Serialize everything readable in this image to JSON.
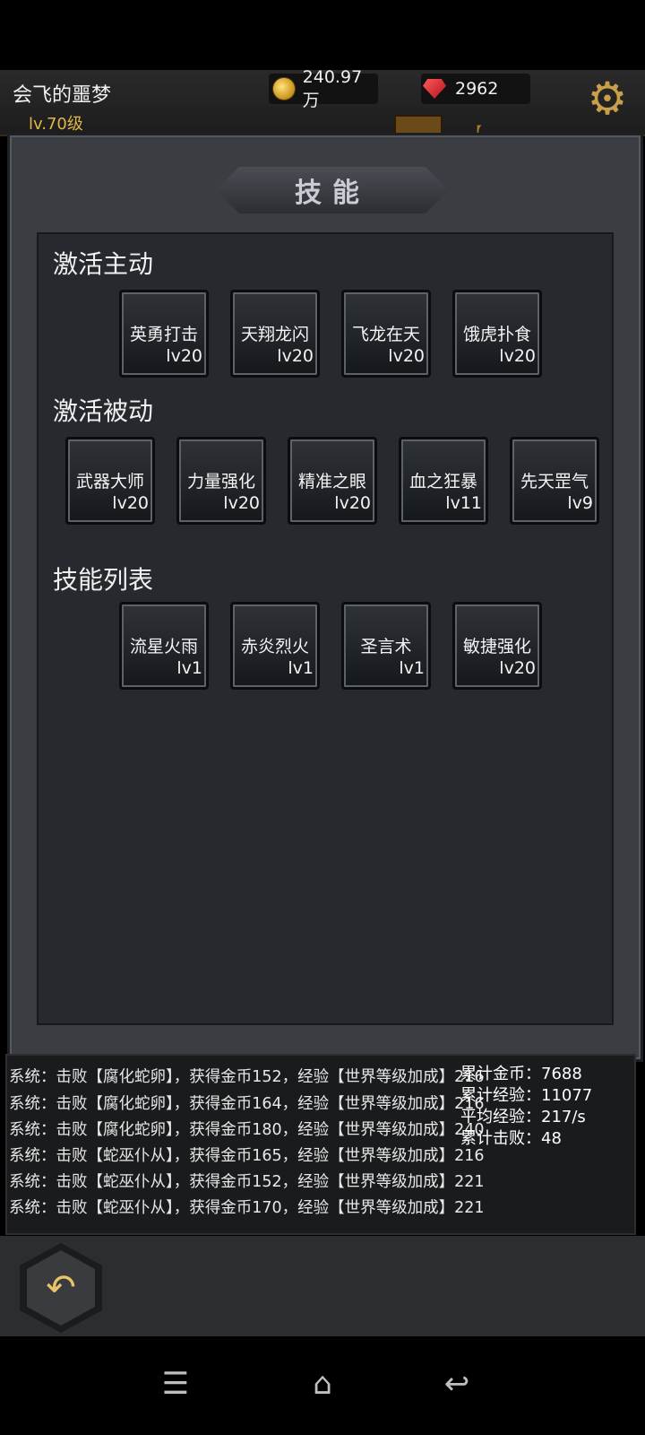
{
  "header": {
    "player_name": "会飞的噩梦",
    "player_level": "lv.70级",
    "gold": "240.97万",
    "gems": "2962",
    "partial_banner": "【"
  },
  "panel": {
    "title": "技能",
    "sections": [
      {
        "title": "激活主动",
        "skills": [
          {
            "name": "英勇打击",
            "level": "lv20"
          },
          {
            "name": "天翔龙闪",
            "level": "lv20"
          },
          {
            "name": "飞龙在天",
            "level": "lv20"
          },
          {
            "name": "饿虎扑食",
            "level": "lv20"
          }
        ]
      },
      {
        "title": "激活被动",
        "skills": [
          {
            "name": "武器大师",
            "level": "lv20"
          },
          {
            "name": "力量强化",
            "level": "lv20"
          },
          {
            "name": "精准之眼",
            "level": "lv20"
          },
          {
            "name": "血之狂暴",
            "level": "lv11"
          },
          {
            "name": "先天罡气",
            "level": "lv9"
          }
        ]
      },
      {
        "title": "技能列表",
        "skills": [
          {
            "name": "流星火雨",
            "level": "lv1"
          },
          {
            "name": "赤炎烈火",
            "level": "lv1"
          },
          {
            "name": "圣言术",
            "level": "lv1"
          },
          {
            "name": "敏捷强化",
            "level": "lv20"
          }
        ]
      }
    ]
  },
  "log": [
    "系统：击败【腐化蛇卵】，获得金币152，经验【世界等级加成】216",
    "系统：击败【腐化蛇卵】，获得金币164，经验【世界等级加成】216",
    "系统：击败【腐化蛇卵】，获得金币180，经验【世界等级加成】240",
    "系统：击败【蛇巫仆从】，获得金币165，经验【世界等级加成】216",
    "系统：击败【蛇巫仆从】，获得金币152，经验【世界等级加成】221",
    "系统：击败【蛇巫仆从】，获得金币170，经验【世界等级加成】221"
  ],
  "stats": [
    "累计金币：7688",
    "累计经验：11077",
    "平均经验：217/s",
    "累计击败：48"
  ],
  "icons": {
    "gold": "gold-coin-icon",
    "gem": "red-gem-icon",
    "settings": "gear-icon",
    "back": "back-arrow-icon",
    "nav_menu": "menu-icon",
    "nav_home": "home-icon",
    "nav_back": "return-icon"
  },
  "colors": {
    "level_text": "#e0b64a",
    "panel_bg": "#3a3d42",
    "inner_bg": "#26292d"
  }
}
